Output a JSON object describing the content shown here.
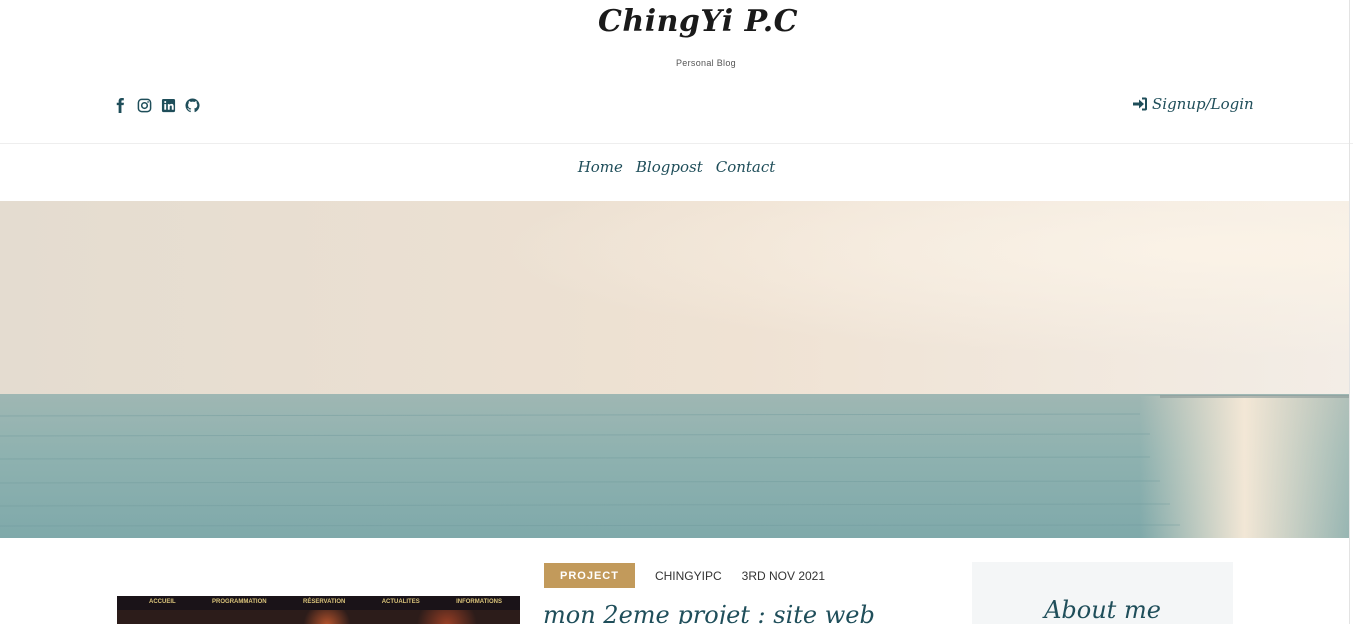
{
  "header": {
    "site_title": "ChingYi P.C",
    "tagline": "Personal Blog"
  },
  "social": {
    "icons": [
      "facebook-icon",
      "instagram-icon",
      "linkedin-icon",
      "github-icon"
    ]
  },
  "auth": {
    "label": "Signup/Login",
    "icon": "sign-in-icon"
  },
  "nav": {
    "items": [
      "Home",
      "Blogpost",
      "Contact"
    ]
  },
  "hero": {
    "image": "sea-horizon-sunset"
  },
  "featured_post": {
    "thumbnail_nav": [
      "ACCUEIL",
      "PROGRAMMATION",
      "RÉSERVATION",
      "ACTUALITES",
      "INFORMATIONS"
    ],
    "category": "PROJECT",
    "author": "CHINGYIPC",
    "date": "3RD NOV 2021",
    "title": "mon 2eme projet : site web"
  },
  "sidebar": {
    "about_title": "About me"
  },
  "colors": {
    "accent": "#c29a5b",
    "brand_text": "#1f4e5a",
    "aside_bg": "#f4f6f7"
  }
}
